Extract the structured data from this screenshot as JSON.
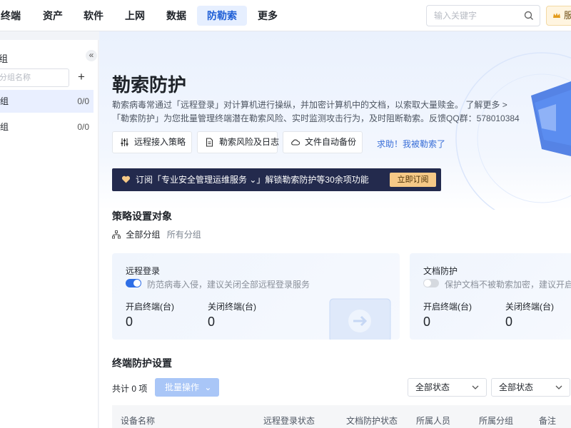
{
  "topnav": {
    "items": [
      "终端",
      "资产",
      "软件",
      "上网",
      "数据",
      "防勒索",
      "更多"
    ],
    "active_index": 5,
    "search_placeholder": "输入关键字",
    "service_label": "服"
  },
  "sidebar": {
    "title": "组",
    "search_placeholder": "分组名称",
    "add_label": "+",
    "collapse_label": "«",
    "groups": [
      {
        "label": "组",
        "count": "0/0",
        "active": true
      },
      {
        "label": "组",
        "count": "0/0",
        "active": false
      }
    ]
  },
  "header": {
    "title": "勒索防护",
    "desc_line1": "勒索病毒常通过「远程登录」对计算机进行操纵，并加密计算机中的文档，以索取大量赎金。",
    "learn_more": "了解更多 >",
    "desc_line2": "「勒索防护」为您批量管理终端潜在勒索风险、实时监测攻击行为，及时阻断勒索。反馈QQ群：578010384"
  },
  "actions": {
    "buttons": [
      {
        "label": "远程接入策略",
        "icon": "sliders-icon"
      },
      {
        "label": "勒索风险及日志",
        "icon": "document-icon"
      },
      {
        "label": "文件自动备份",
        "icon": "cloud-icon"
      }
    ],
    "help_link": "求助！我被勒索了"
  },
  "promo": {
    "text": "订阅「专业安全管理运维服务 ⌄」解锁勒索防护等30余项功能",
    "button": "立即订阅",
    "icon": "heart-icon"
  },
  "policy": {
    "section_title": "策略设置对象",
    "scope_label": "全部分组",
    "scope_value": "所有分组"
  },
  "cards": [
    {
      "title": "远程登录",
      "enabled": true,
      "desc": "防范病毒入侵，建议关闭全部远程登录服务",
      "on_label": "开启终端(台)",
      "on_value": "0",
      "off_label": "关闭终端(台)",
      "off_value": "0"
    },
    {
      "title": "文档防护",
      "enabled": false,
      "desc": "保护文档不被勒索加密，建议开启全",
      "on_label": "开启终端(台)",
      "on_value": "0",
      "off_label": "关闭终端(台)",
      "off_value": "0"
    }
  ],
  "endpoint": {
    "section_title": "终端防护设置",
    "total": "共计 0 项",
    "bulk_button": "批量操作",
    "filter1": "全部状态",
    "filter2": "全部状态",
    "columns": [
      "设备名称",
      "远程登录状态",
      "文档防护状态",
      "所属人员",
      "所属分组",
      "备注"
    ]
  },
  "colors": {
    "accent": "#2f6fe6",
    "promo_bg": "#232a4d",
    "promo_button": "#f6c987"
  }
}
